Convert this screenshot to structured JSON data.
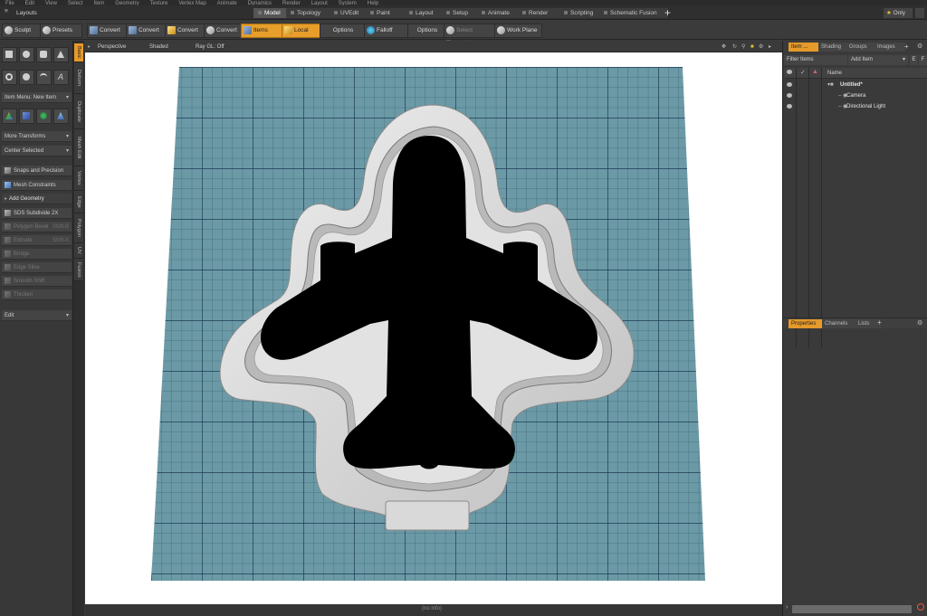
{
  "menu": [
    "File",
    "Edit",
    "View",
    "Select",
    "Item",
    "Geometry",
    "Texture",
    "Vertex Map",
    "Animate",
    "Dynamics",
    "Render",
    "Layout",
    "System",
    "Help"
  ],
  "layouts_label": "Layouts",
  "layout_tabs": [
    {
      "label": "Model",
      "active": true
    },
    {
      "label": "Topology",
      "active": false
    },
    {
      "label": "UVEdit",
      "active": false
    },
    {
      "label": "Paint",
      "active": false
    },
    {
      "label": "Layout",
      "active": false
    },
    {
      "label": "Setup",
      "active": false
    },
    {
      "label": "Animate",
      "active": false
    },
    {
      "label": "Render",
      "active": false
    },
    {
      "label": "Scripting",
      "active": false
    },
    {
      "label": "Schematic Fusion",
      "active": false
    }
  ],
  "only_label": "Only",
  "toolbar": {
    "sculpt": "Sculpt",
    "presets": "Presets",
    "convert_labels": [
      "Convert",
      "Convert",
      "Convert",
      "Convert"
    ],
    "items": "Items",
    "local": "Local",
    "options1": "Options",
    "falloff": "Falloff",
    "options2": "Options",
    "select_through": "Select Through",
    "work_plane": "Work Plane"
  },
  "left_panel": {
    "item_menu": "Item Menu: New Item",
    "more_transforms": "More Transforms",
    "center_selected": "Center Selected",
    "snaps": "Snaps and Precision",
    "mesh_constraints": "Mesh Constraints",
    "add_geometry": "Add Geometry",
    "tools": [
      {
        "label": "SDS Subdivide 2X",
        "shortcut": "",
        "enabled": true
      },
      {
        "label": "Polygon Bevel",
        "shortcut": "Shift-B",
        "enabled": false
      },
      {
        "label": "Extrude",
        "shortcut": "Shift-X",
        "enabled": false
      },
      {
        "label": "Bridge",
        "shortcut": "",
        "enabled": false
      },
      {
        "label": "Edge Slice",
        "shortcut": "",
        "enabled": false
      },
      {
        "label": "Smooth Shift",
        "shortcut": "",
        "enabled": false
      },
      {
        "label": "Thicken",
        "shortcut": "",
        "enabled": false
      }
    ],
    "edit": "Edit"
  },
  "vertical_tabs": [
    {
      "label": "Basic",
      "active": true
    },
    {
      "label": "Deform",
      "active": false
    },
    {
      "label": "Duplicate",
      "active": false
    },
    {
      "label": "Mesh Edit",
      "active": false
    },
    {
      "label": "Vertex",
      "active": false
    },
    {
      "label": "Edge",
      "active": false
    },
    {
      "label": "Polygon",
      "active": false
    },
    {
      "label": "UV",
      "active": false
    },
    {
      "label": "Fusion",
      "active": false
    }
  ],
  "viewport": {
    "perspective": "Perspective",
    "shaded": "Shaded",
    "raygl": "Ray GL: Off",
    "status": "(no info)"
  },
  "right_panel": {
    "tabs": [
      {
        "label": "Item ...",
        "active": true
      },
      {
        "label": "Shading",
        "active": false
      },
      {
        "label": "Groups",
        "active": false
      },
      {
        "label": "Images",
        "active": false
      }
    ],
    "filter_items": "Filter Items",
    "add_item": "Add Item",
    "e_label": "E",
    "f_label": "F",
    "name_header": "Name",
    "tree": [
      {
        "label": "Untitled*",
        "level": 0
      },
      {
        "label": "Camera",
        "level": 1
      },
      {
        "label": "Directional Light",
        "level": 1
      }
    ],
    "bottom_tabs": [
      {
        "label": "Properties",
        "active": true
      },
      {
        "label": "Channels",
        "active": false
      },
      {
        "label": "Lists",
        "active": false
      }
    ]
  },
  "colors": {
    "accent": "#e79e2b",
    "grid_bg": "#6b9aa6",
    "grid_minor": "#3f6878",
    "grid_major": "#1d3a55",
    "cutter": "#d8d8d8",
    "silhouette": "#000000"
  }
}
